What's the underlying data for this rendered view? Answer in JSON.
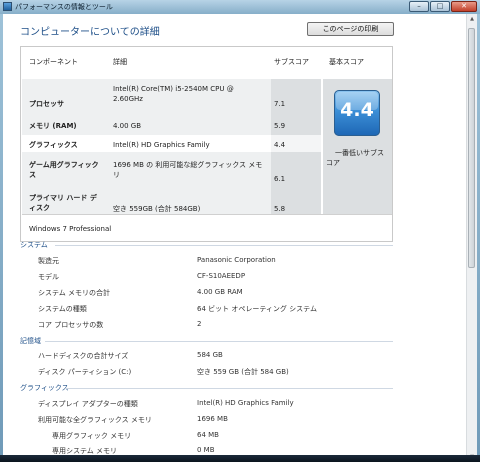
{
  "window": {
    "title": "パフォーマンスの情報とツール",
    "controls": {
      "minimize": "–",
      "maximize": "□",
      "close": "✕"
    }
  },
  "page": {
    "title": "コンピューターについての詳細",
    "print_button": "このページの印刷"
  },
  "score_table": {
    "headers": {
      "component": "コンポーネント",
      "detail": "詳細",
      "subscore": "サブスコア",
      "base": "基本スコア"
    },
    "rows": [
      {
        "component": "プロセッサ",
        "detail_line1": "Intel(R) Core(TM) i5-2540M CPU @",
        "detail_line2": "2.60GHz",
        "subscore": "7.1"
      },
      {
        "component": "メモリ (RAM)",
        "detail_line1": "4.00 GB",
        "detail_line2": "",
        "subscore": "5.9"
      },
      {
        "component": "グラフィックス",
        "detail_line1": "Intel(R) HD Graphics Family",
        "detail_line2": "",
        "subscore": "4.4"
      },
      {
        "component_line1": "ゲーム用グラフィック",
        "component_line2": "ス",
        "detail_line1": "1696 MB の 利用可能な総グラフィックス メモ",
        "detail_line2": "リ",
        "subscore": "6.1"
      },
      {
        "component_line1": "プライマリ ハード デ",
        "component_line2": "ィスク",
        "detail_line1": "空き 559GB (合計 584GB)",
        "detail_line2": "",
        "subscore": "5.8"
      }
    ],
    "base_score": "4.4",
    "base_caption_line1": "一番低いサブス",
    "base_caption_line2": "コア",
    "os": "Windows 7 Professional"
  },
  "groups": {
    "system": {
      "title": "システム",
      "rows": [
        {
          "label": "製造元",
          "value": "Panasonic Corporation"
        },
        {
          "label": "モデル",
          "value": "CF-S10AEEDP"
        },
        {
          "label": "システム メモリの合計",
          "value": "4.00 GB RAM"
        },
        {
          "label": "システムの種類",
          "value": "64 ビット オペレーティング システム"
        },
        {
          "label": "コア プロセッサの数",
          "value": "2"
        }
      ]
    },
    "storage": {
      "title": "記憶域",
      "rows": [
        {
          "label": "ハードディスクの合計サイズ",
          "value": "584 GB"
        },
        {
          "label": "ディスク パーティション (C:)",
          "value": "空き 559 GB (合計 584 GB)"
        }
      ]
    },
    "graphics": {
      "title": "グラフィックス",
      "rows": [
        {
          "label": "ディスプレイ アダプターの種類",
          "value": "Intel(R) HD Graphics Family"
        },
        {
          "label": "利用可能な全グラフィックス メモリ",
          "value": "1696 MB"
        },
        {
          "label": "専用グラフィック メモリ",
          "value": "64 MB"
        },
        {
          "label": "専用システム メモリ",
          "value": "0 MB"
        }
      ]
    }
  },
  "scrollbar": {
    "up": "▲",
    "down": "▼"
  }
}
